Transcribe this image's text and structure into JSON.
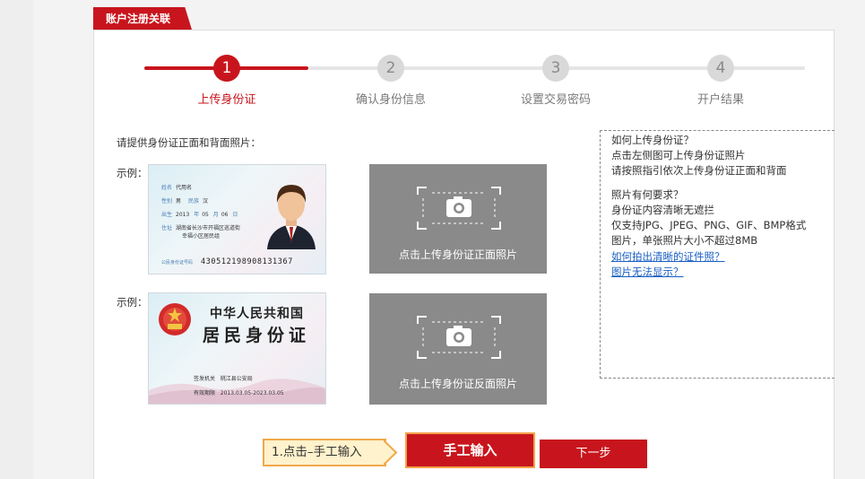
{
  "panel": {
    "tab_label": "账户注册关联"
  },
  "steps": [
    {
      "number": "1",
      "label": "上传身份证",
      "active": true
    },
    {
      "number": "2",
      "label": "确认身份信息",
      "active": false
    },
    {
      "number": "3",
      "label": "设置交易密码",
      "active": false
    },
    {
      "number": "4",
      "label": "开户结果",
      "active": false
    }
  ],
  "upload": {
    "instruction": "请提供身份证正面和背面照片：",
    "example_label": "示例：",
    "front_button": "点击上传身份证正面照片",
    "back_button": "点击上传身份证反面照片"
  },
  "sample_front": {
    "name_lbl": "姓名",
    "name": "代用名",
    "sex_lbl": "性别",
    "sex": "男",
    "nation_lbl": "民族",
    "nation": "汉",
    "birth_lbl": "出生",
    "year": "2013",
    "year_unit": "年",
    "month": "05",
    "month_unit": "月",
    "day": "06",
    "day_unit": "日",
    "addr_lbl": "住址",
    "addr1": "湖南省长沙市开福区巡道街",
    "addr2": "幸福小区居民组",
    "id_lbl": "公民身份证号码",
    "id_number": "430512198908131367"
  },
  "sample_back": {
    "title1": "中华人民共和国",
    "title2": "居民身份证",
    "authority_lbl": "签发机关",
    "authority": "桃江县公安局",
    "validity_lbl": "有效期限",
    "validity": "2013.03.05-2023.03.05"
  },
  "help": {
    "q1": "如何上传身份证？",
    "a1_1": "点击左侧图可上传身份证照片",
    "a1_2": "请按照指引依次上传身份证正面和背面",
    "q2": "照片有何要求？",
    "a2_1": "身份证内容清晰无遮拦",
    "a2_2": "仅支持JPG、JPEG、PNG、GIF、BMP格式",
    "a2_3": "图片，单张照片大小不超过8MB",
    "link1": "如何拍出清晰的证件照？",
    "link2": "图片无法显示？"
  },
  "actions": {
    "callout": "1.点击–手工输入",
    "manual_input": "手工输入",
    "next": "下一步"
  },
  "colors": {
    "brand_red": "#c8151d",
    "callout_bg": "#fff2cc",
    "callout_border": "#f0a94a",
    "link": "#1a5fc4"
  }
}
